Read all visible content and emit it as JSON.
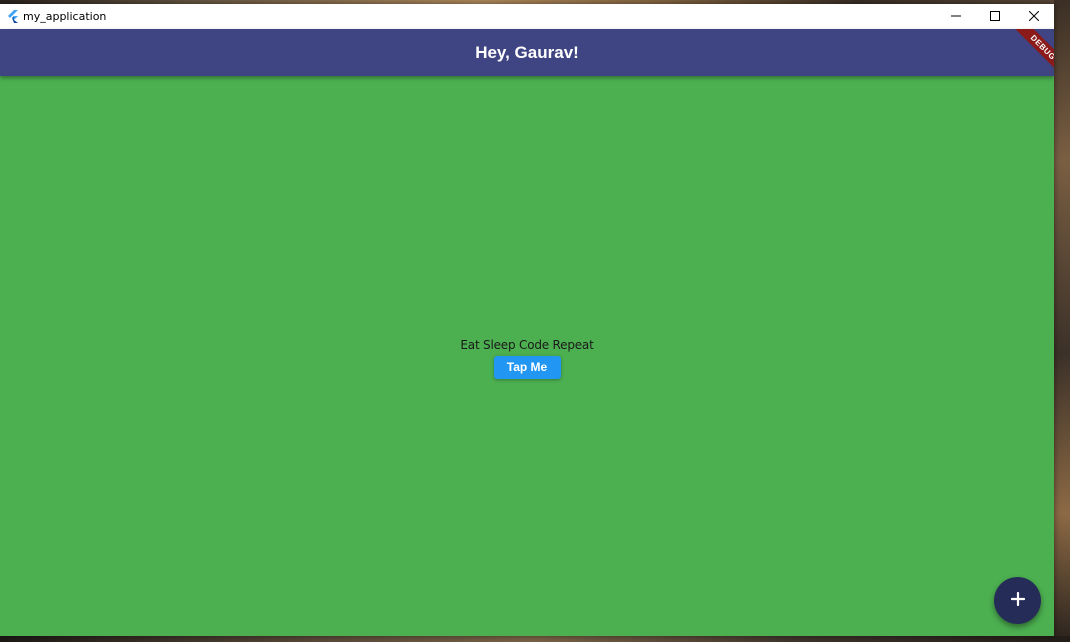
{
  "window": {
    "title": "my_application",
    "icon": "flutter-logo-icon",
    "controls": [
      "minimize-icon",
      "maximize-icon",
      "close-icon"
    ]
  },
  "appbar": {
    "title": "Hey, Gaurav!",
    "color": "#3f4483"
  },
  "debug_banner": {
    "label": "DEBUG",
    "color": "#8b1a1a"
  },
  "body": {
    "background": "#4caf50",
    "tagline": "Eat Sleep Code Repeat",
    "button_label": "Tap Me",
    "button_color": "#2196f3"
  },
  "fab": {
    "icon": "plus-icon",
    "color": "#262c58"
  }
}
